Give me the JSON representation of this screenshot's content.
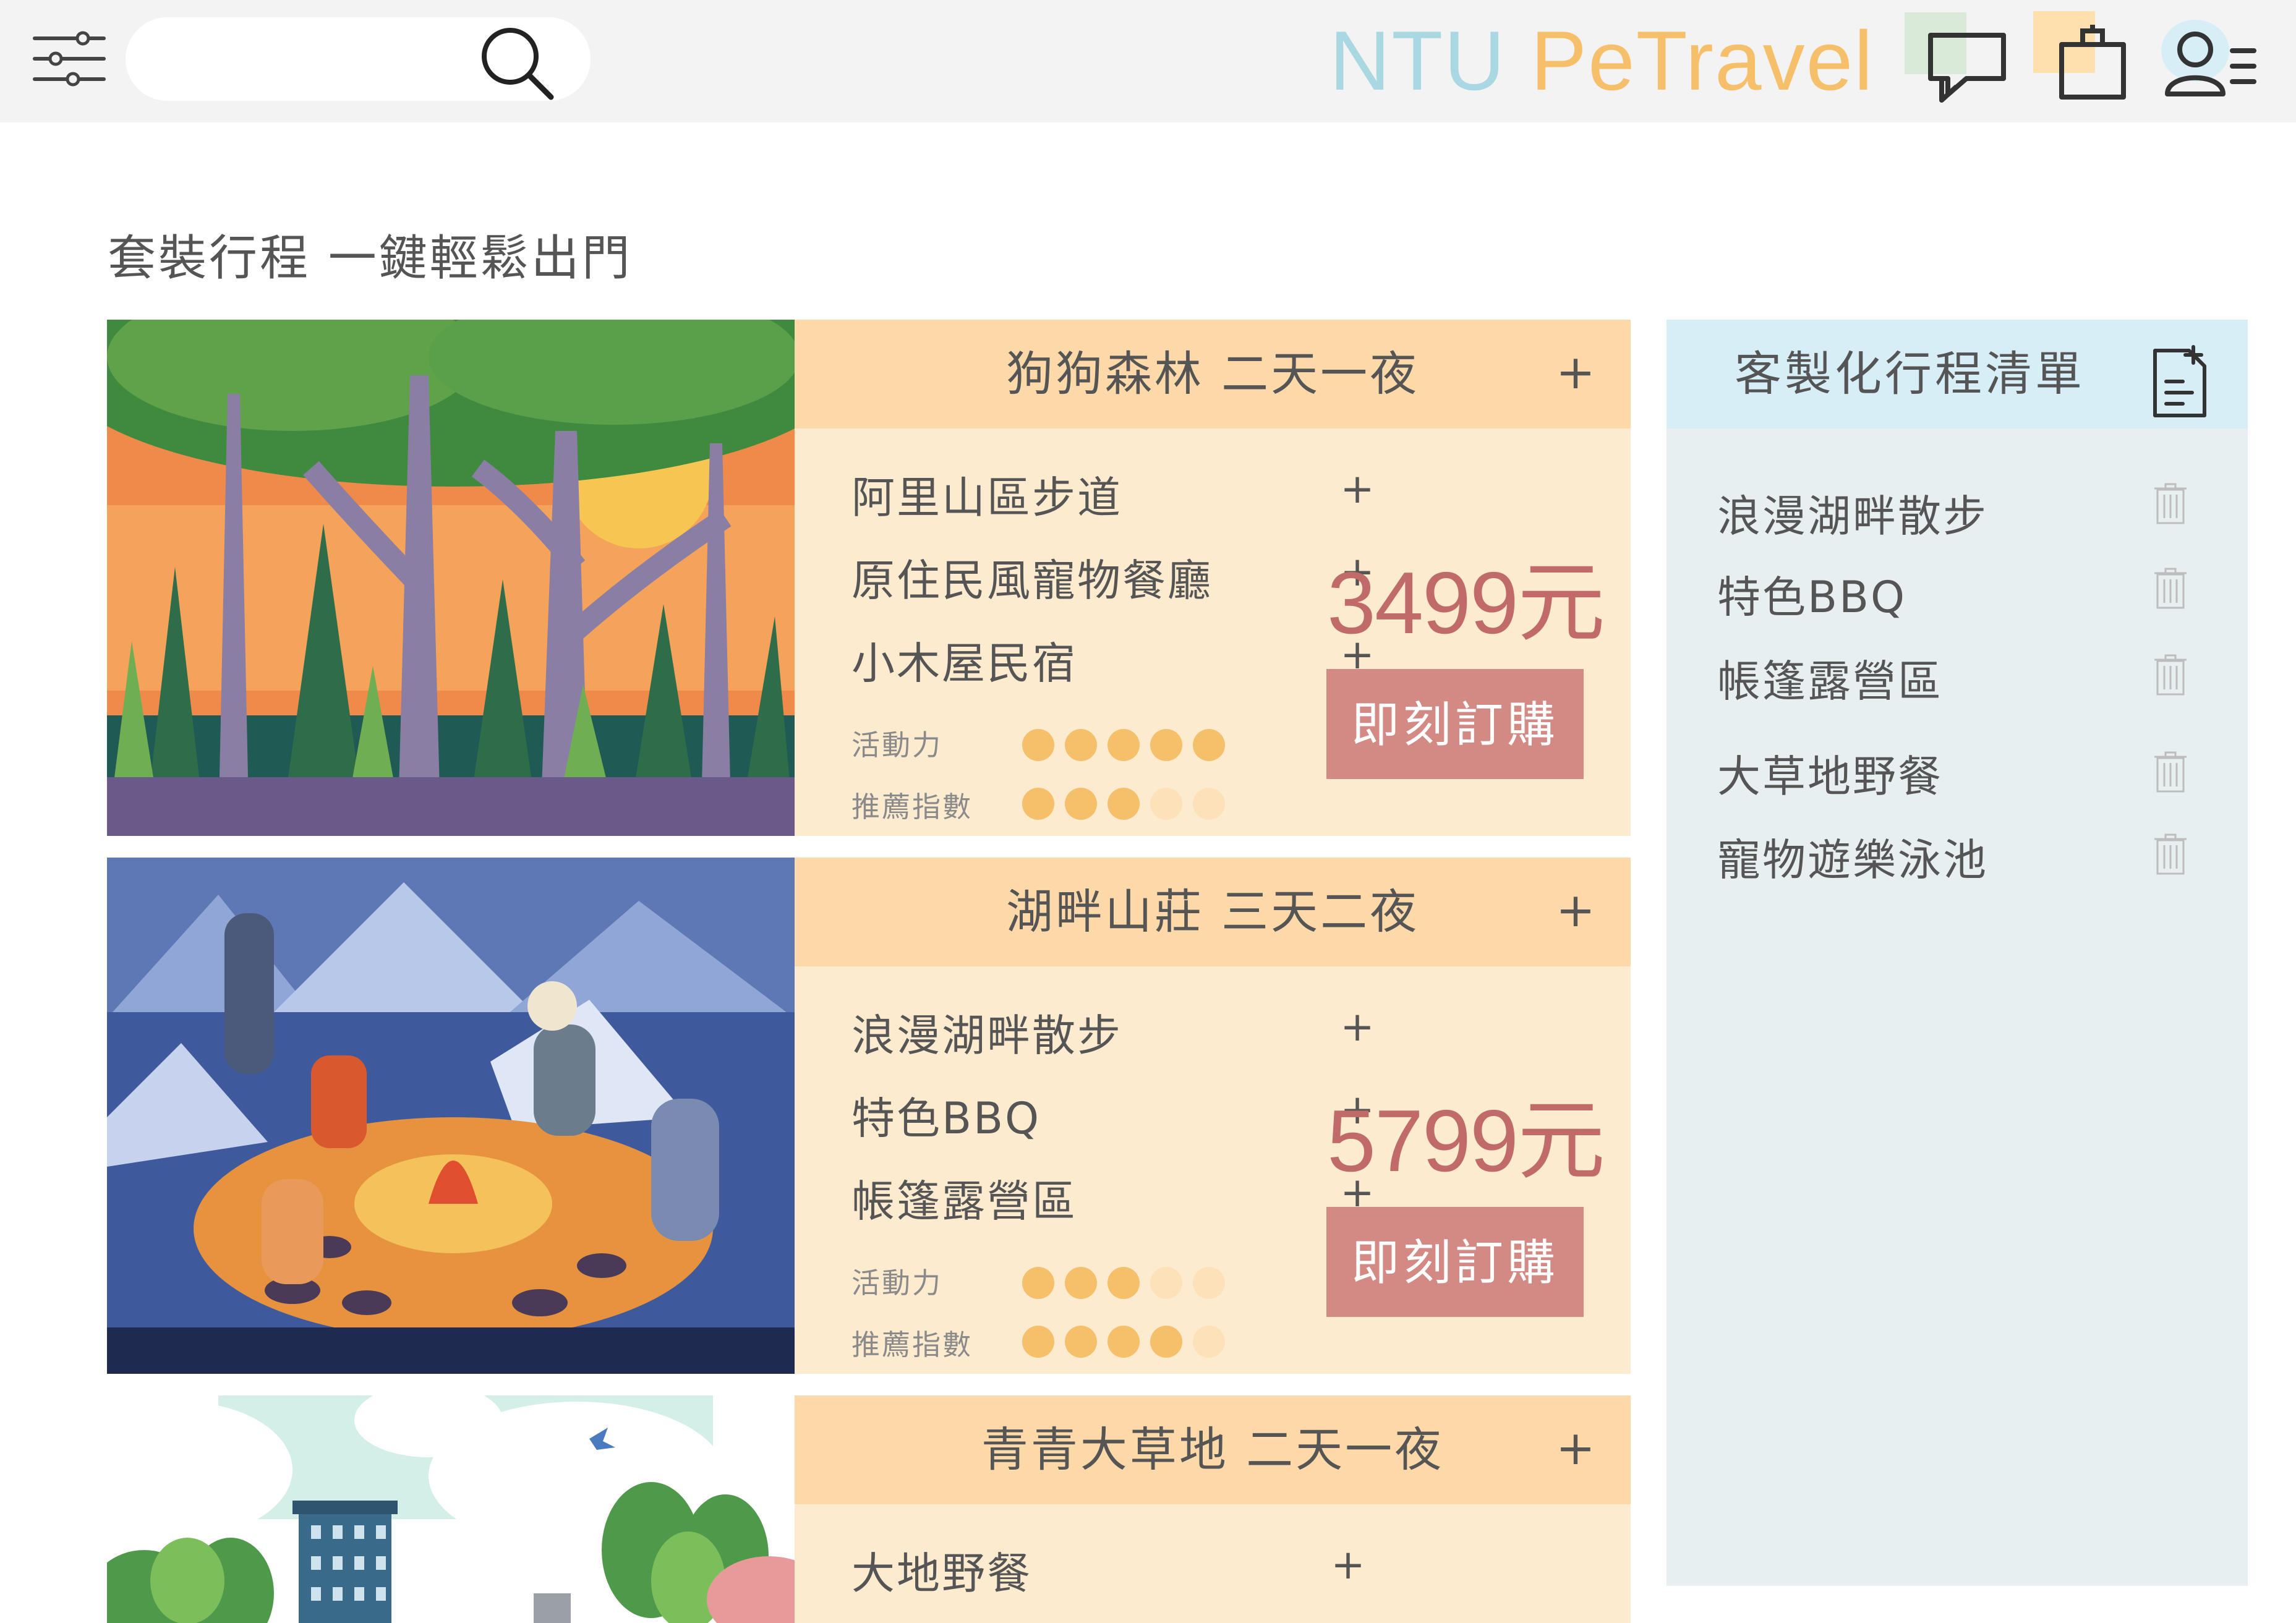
{
  "header": {
    "brand": [
      "NTU",
      "PeTravel"
    ],
    "search": {
      "value": "",
      "placeholder": ""
    },
    "icons": [
      "filter-sliders-icon",
      "search-icon",
      "chat-icon",
      "shopping-bag-icon",
      "user-menu-icon"
    ],
    "colors": {
      "bar": "#f3f3f3",
      "brand_blue": "#a9d8e2",
      "brand_orange": "#f6c06a",
      "brand_green": "#b9e0bf"
    }
  },
  "page": {
    "title": "套裝行程 一鍵輕鬆出門"
  },
  "packages": [
    {
      "title": "狗狗森林 二天一夜",
      "items": [
        "阿里山區步道",
        "原住民風寵物餐廳",
        "小木屋民宿"
      ],
      "activity_label": "活動力",
      "activity": 5,
      "recommend_label": "推薦指數",
      "recommend": 3,
      "price": "3499元",
      "buy_label": "即刻訂購",
      "image": "forest-sunset-illustration"
    },
    {
      "title": "湖畔山莊 三天二夜",
      "items": [
        "浪漫湖畔散步",
        "特色BBQ",
        "帳篷露營區"
      ],
      "activity_label": "活動力",
      "activity": 3,
      "recommend_label": "推薦指數",
      "recommend": 4,
      "price": "5799元",
      "buy_label": "即刻訂購",
      "image": "campfire-night-illustration"
    },
    {
      "title": "青青大草地 二天一夜",
      "items": [
        "大地野餐"
      ],
      "image": "meadow-city-illustration"
    }
  ],
  "custom_list": {
    "title": "客製化行程清單",
    "items": [
      "浪漫湖畔散步",
      "特色BBQ",
      "帳篷露營區",
      "大草地野餐",
      "寵物遊樂泳池"
    ],
    "colors": {
      "head": "#d7eef6",
      "body": "#e8eff1"
    }
  },
  "colors": {
    "card_head": "#fdd8a8",
    "card_body": "#fdebcf",
    "price": "#c06a6a",
    "button": "#d48a84",
    "dot_on": "#f6c06a",
    "dot_off": "#fde1b8"
  }
}
